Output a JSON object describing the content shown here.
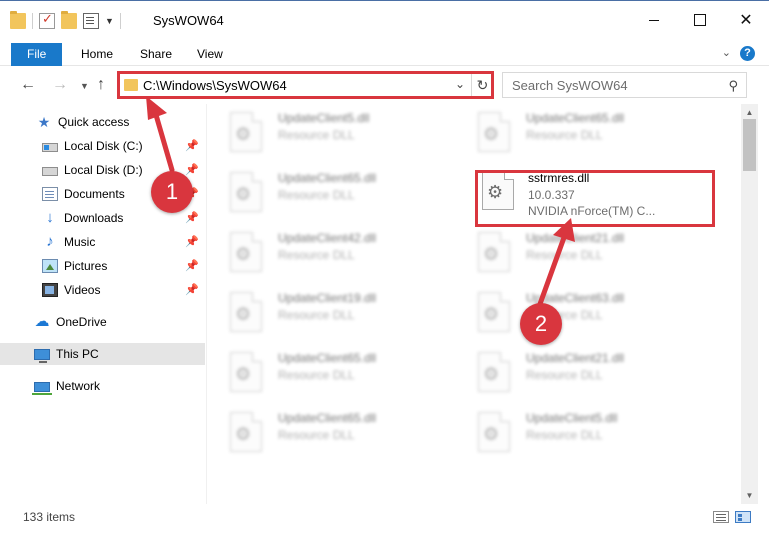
{
  "window": {
    "title": "SysWOW64",
    "controls": {
      "minimize": "",
      "maximize": "",
      "close": "✕"
    }
  },
  "ribbon": {
    "tabs": [
      "File",
      "Home",
      "Share",
      "View"
    ],
    "expand_icon": "chevron-down",
    "help": "?"
  },
  "address": {
    "path": "C:\\Windows\\SysWOW64",
    "search_placeholder": "Search SysWOW64"
  },
  "nav": {
    "quick_access": "Quick access",
    "items": [
      {
        "label": "Local Disk (C:)",
        "icon": "drive-icon",
        "pinned": true
      },
      {
        "label": "Local Disk (D:)",
        "icon": "drive-icon",
        "pinned": true
      },
      {
        "label": "Documents",
        "icon": "documents-icon",
        "pinned": true
      },
      {
        "label": "Downloads",
        "icon": "downloads-icon",
        "pinned": true
      },
      {
        "label": "Music",
        "icon": "music-icon",
        "pinned": true
      },
      {
        "label": "Pictures",
        "icon": "pictures-icon",
        "pinned": true
      },
      {
        "label": "Videos",
        "icon": "videos-icon",
        "pinned": true
      }
    ],
    "onedrive": "OneDrive",
    "this_pc": "This PC",
    "network": "Network"
  },
  "files": [
    {
      "name": "UpdateClient5.dll",
      "type": "Resource DLL"
    },
    {
      "name": "UpdateClient65.dll",
      "type": "Resource DLL"
    },
    {
      "name": "UpdateClient65.dll",
      "type": "Resource DLL"
    },
    {
      "name": "sstrmres.dll",
      "version": "10.0.337",
      "description": "NVIDIA nForce(TM) C..."
    },
    {
      "name": "UpdateClient42.dll",
      "type": "Resource DLL"
    },
    {
      "name": "UpdateClient21.dll",
      "type": "Resource DLL"
    },
    {
      "name": "UpdateClient19.dll",
      "type": "Resource DLL"
    },
    {
      "name": "UpdateClient63.dll",
      "type": "Resource DLL"
    },
    {
      "name": "UpdateClient65.dll",
      "type": "Resource DLL"
    },
    {
      "name": "UpdateClient21.dll",
      "type": "Resource DLL"
    },
    {
      "name": "UpdateClient65.dll",
      "type": "Resource DLL"
    },
    {
      "name": "UpdateClient5.dll",
      "type": "Resource DLL"
    }
  ],
  "status": {
    "count": "133 items"
  },
  "annotations": {
    "step1": "1",
    "step2": "2",
    "color": "#d9363e"
  },
  "colors": {
    "accent": "#1979ca",
    "highlight": "#d9363e"
  }
}
